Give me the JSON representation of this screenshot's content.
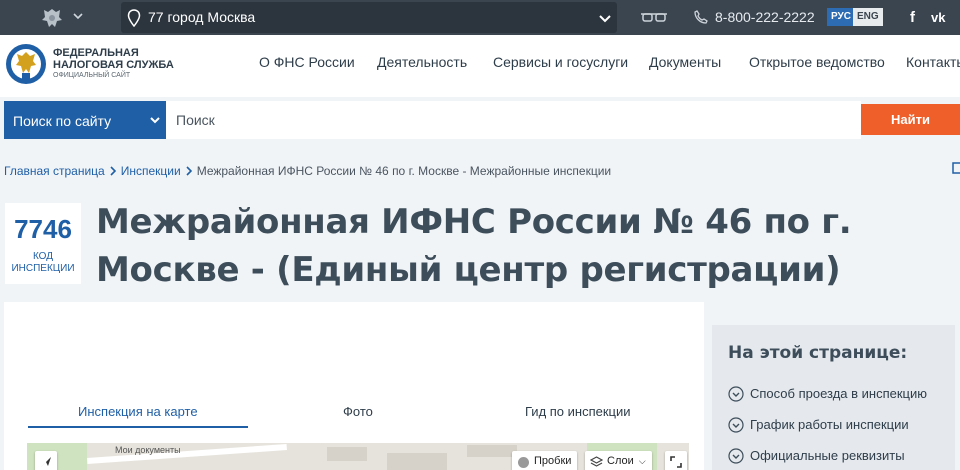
{
  "topbar": {
    "region": "77 город Москва",
    "phone": "8-800-222-2222",
    "lang_ru": "РУС",
    "lang_en": "ENG",
    "social_fb": "f",
    "social_vk": "vk"
  },
  "header": {
    "logo_line1": "ФЕДЕРАЛЬНАЯ",
    "logo_line2": "НАЛОГОВАЯ СЛУЖБА",
    "logo_line3": "ОФИЦИАЛЬНЫЙ САЙТ",
    "nav": [
      "О ФНС России",
      "Деятельность",
      "Сервисы и госуслуги",
      "Документы",
      "Открытое ведомство",
      "Контакты"
    ]
  },
  "search": {
    "scope": "Поиск по сайту",
    "placeholder": "Поиск",
    "button": "Найти"
  },
  "breadcrumb": {
    "items": [
      "Главная страница",
      "Инспекции"
    ],
    "current": "Межрайонная ИФНС России № 46 по г. Москве - Межрайонные инспекции"
  },
  "inspection": {
    "code": "7746",
    "code_label1": "КОД",
    "code_label2": "ИНСПЕКЦИИ",
    "title": "Межрайонная ИФНС России № 46 по г. Москве - (Единый центр регистрации)"
  },
  "tabs": [
    "Инспекция на карте",
    "Фото",
    "Гид по инспекции"
  ],
  "map": {
    "label": "Мои документы",
    "traffic": "Пробки",
    "layers": "Слои"
  },
  "sidebar": {
    "heading": "На этой странице:",
    "items": [
      "Способ проезда в инспекцию",
      "График работы инспекции",
      "Официальные реквизиты"
    ]
  },
  "colors": {
    "topbar": "#3a4550",
    "brand_blue": "#1f5fa6",
    "accent_orange": "#ee5f2a"
  }
}
